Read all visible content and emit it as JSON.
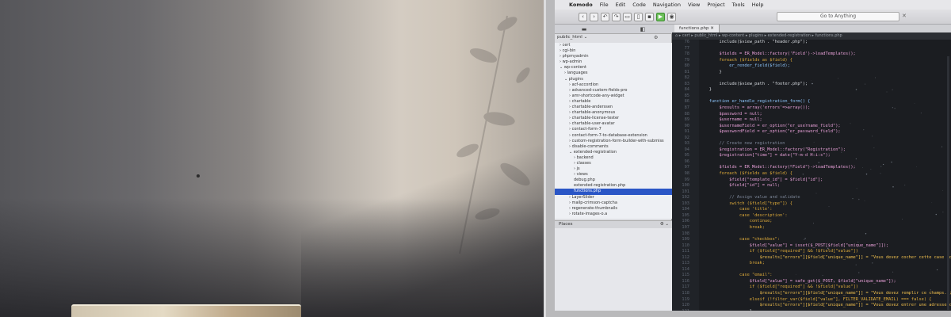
{
  "menubar": {
    "app_name": "Komodo",
    "items": [
      "File",
      "Edit",
      "Code",
      "Navigation",
      "View",
      "Project",
      "Tools",
      "Help"
    ]
  },
  "toolbar": {
    "goto_placeholder": "Go to Anything"
  },
  "left_pane": {
    "project": "public_html",
    "places_label": "Places",
    "tree": [
      {
        "label": "› cert",
        "indent": 1,
        "selected": false
      },
      {
        "label": "› cgi-bin",
        "indent": 1,
        "selected": false
      },
      {
        "label": "› phpmyadmin",
        "indent": 1,
        "selected": false
      },
      {
        "label": "› wp-admin",
        "indent": 1,
        "selected": false
      },
      {
        "label": "⌄ wp-content",
        "indent": 1,
        "selected": false
      },
      {
        "label": "› languages",
        "indent": 2,
        "selected": false
      },
      {
        "label": "⌄ plugins",
        "indent": 2,
        "selected": false
      },
      {
        "label": "› acf-accordion",
        "indent": 3,
        "selected": false
      },
      {
        "label": "› advanced-custom-fields-pro",
        "indent": 3,
        "selected": false
      },
      {
        "label": "› amr-shortcode-any-widget",
        "indent": 3,
        "selected": false
      },
      {
        "label": "› chartable",
        "indent": 3,
        "selected": false
      },
      {
        "label": "› chartable-anderssen",
        "indent": 3,
        "selected": false
      },
      {
        "label": "› chartable-anonymous",
        "indent": 3,
        "selected": false
      },
      {
        "label": "› chartable-license-tester",
        "indent": 3,
        "selected": false
      },
      {
        "label": "› chartable-user-avatar",
        "indent": 3,
        "selected": false
      },
      {
        "label": "› contact-form-7",
        "indent": 3,
        "selected": false
      },
      {
        "label": "› contact-form-7-to-database-extension",
        "indent": 3,
        "selected": false
      },
      {
        "label": "› custom-registration-form-builder-with-submiss",
        "indent": 3,
        "selected": false
      },
      {
        "label": "› disable-comments",
        "indent": 3,
        "selected": false
      },
      {
        "label": "⌄ extended-registration",
        "indent": 3,
        "selected": false
      },
      {
        "label": "› backend",
        "indent": 4,
        "selected": false
      },
      {
        "label": "› classes",
        "indent": 4,
        "selected": false
      },
      {
        "label": "› js",
        "indent": 4,
        "selected": false
      },
      {
        "label": "› views",
        "indent": 4,
        "selected": false
      },
      {
        "label": "debug.php",
        "indent": 4,
        "selected": false
      },
      {
        "label": "extended-registration.php",
        "indent": 4,
        "selected": false
      },
      {
        "label": "functions.php",
        "indent": 4,
        "selected": true
      },
      {
        "label": "› LayerSlider",
        "indent": 3,
        "selected": false
      },
      {
        "label": "› mailp-crimson-captcha",
        "indent": 3,
        "selected": false
      },
      {
        "label": "› regenerate-thumbnails",
        "indent": 3,
        "selected": false
      },
      {
        "label": "› rotate-images-o.a",
        "indent": 3,
        "selected": false
      }
    ]
  },
  "editor": {
    "tab_label": "functions.php",
    "breadcrumb": "⌂ ▸ cert ▸ public_html ▸ wp-content ▸ plugins ▸ extended-registration ▸ functions.php",
    "colors": {
      "default": "#d7dbe0",
      "keyword": "#e0ac3a",
      "variable": "#e8a0d8",
      "string": "#f2c14e",
      "comment": "#7d8799",
      "function": "#8fc8ff",
      "symbol": "#e06c75"
    },
    "lines": [
      {
        "n": 76,
        "text": "        include($view_path . \"header.php\");",
        "color": "default"
      },
      {
        "n": 77,
        "text": "",
        "color": "default"
      },
      {
        "n": 78,
        "text": "        $fields = ER_Model::factory('Field')->loadTemplates();",
        "color": "variable"
      },
      {
        "n": 79,
        "text": "        foreach ($fields as $field) {",
        "color": "keyword"
      },
      {
        "n": 80,
        "text": "            er_render_field($field);",
        "color": "function"
      },
      {
        "n": 81,
        "text": "        }",
        "color": "default"
      },
      {
        "n": 82,
        "text": "",
        "color": "default"
      },
      {
        "n": 83,
        "text": "        include($view_path . \"footer.php\");",
        "color": "default"
      },
      {
        "n": 84,
        "text": "    }",
        "color": "default"
      },
      {
        "n": 85,
        "text": "",
        "color": "default"
      },
      {
        "n": 86,
        "text": "    function er_handle_registration_form() {",
        "color": "function"
      },
      {
        "n": 87,
        "text": "        $results = array('errors'=>array());",
        "color": "variable"
      },
      {
        "n": 88,
        "text": "        $password = null;",
        "color": "variable"
      },
      {
        "n": 89,
        "text": "        $username = null;",
        "color": "variable"
      },
      {
        "n": 90,
        "text": "        $usernameField = er_option(\"er_username_field\");",
        "color": "variable"
      },
      {
        "n": 91,
        "text": "        $passwordField = er_option(\"er_password_field\");",
        "color": "variable"
      },
      {
        "n": 92,
        "text": "",
        "color": "default"
      },
      {
        "n": 93,
        "text": "        // Create new registration",
        "color": "comment"
      },
      {
        "n": 94,
        "text": "        $registration = ER_Model::factory(\"Registration\");",
        "color": "variable"
      },
      {
        "n": 95,
        "text": "        $registration[\"time\"] = date(\"Y-m-d H:i:s\");",
        "color": "variable"
      },
      {
        "n": 96,
        "text": "",
        "color": "default"
      },
      {
        "n": 97,
        "text": "        $fields = ER_Model::factory(\"Field\")->loadTemplates();",
        "color": "variable"
      },
      {
        "n": 98,
        "text": "        foreach ($fields as $field) {",
        "color": "keyword"
      },
      {
        "n": 99,
        "text": "            $field[\"template_id\"] = $field[\"id\"];",
        "color": "variable"
      },
      {
        "n": 100,
        "text": "            $field[\"id\"] = null;",
        "color": "variable"
      },
      {
        "n": 101,
        "text": "",
        "color": "default"
      },
      {
        "n": 102,
        "text": "            // Assign value and validate",
        "color": "comment"
      },
      {
        "n": 103,
        "text": "            switch ($field[\"type\"]) {",
        "color": "keyword"
      },
      {
        "n": 104,
        "text": "                case 'title':",
        "color": "keyword"
      },
      {
        "n": 105,
        "text": "                case 'description':",
        "color": "keyword"
      },
      {
        "n": 106,
        "text": "                    continue;",
        "color": "keyword"
      },
      {
        "n": 107,
        "text": "                    break;",
        "color": "keyword"
      },
      {
        "n": 108,
        "text": "",
        "color": "default"
      },
      {
        "n": 109,
        "text": "                case \"checkbox\":",
        "color": "keyword"
      },
      {
        "n": 110,
        "text": "                    $field[\"value\"] = isset($_POST[$field[\"unique_name\"]]);",
        "color": "variable"
      },
      {
        "n": 111,
        "text": "                    if ($field[\"required\"] && !$field[\"value\"])",
        "color": "keyword"
      },
      {
        "n": 112,
        "text": "                        $results[\"errors\"][$field[\"unique_name\"]] = \"Vous devez cocher cette case pour continuer\"",
        "color": "string"
      },
      {
        "n": 113,
        "text": "                    break;",
        "color": "keyword"
      },
      {
        "n": 114,
        "text": "",
        "color": "default"
      },
      {
        "n": 115,
        "text": "                case \"email\":",
        "color": "keyword"
      },
      {
        "n": 116,
        "text": "                    $field[\"value\"] = safe_get($_POST, $field[\"unique_name\"]);",
        "color": "variable"
      },
      {
        "n": 117,
        "text": "                    if ($field[\"required\"] && !$field[\"value\"])",
        "color": "keyword"
      },
      {
        "n": 118,
        "text": "                        $results[\"errors\"][$field[\"unique_name\"]] = \"Vous devez remplir ce champs.\";",
        "color": "string"
      },
      {
        "n": 119,
        "text": "                    elseif (!filter_var($field[\"value\"], FILTER_VALIDATE_EMAIL) === false) {",
        "color": "keyword"
      },
      {
        "n": 120,
        "text": "                        $results[\"errors\"][$field[\"unique_name\"]] = \"Vous devez entrer une adresse courriel",
        "color": "string"
      },
      {
        "n": 121,
        "text": "                    }",
        "color": "default"
      },
      {
        "n": 122,
        "text": "                    break;",
        "color": "keyword"
      },
      {
        "n": 123,
        "text": "",
        "color": "default"
      },
      {
        "n": 124,
        "text": "                case \"password\":",
        "color": "keyword"
      }
    ]
  }
}
